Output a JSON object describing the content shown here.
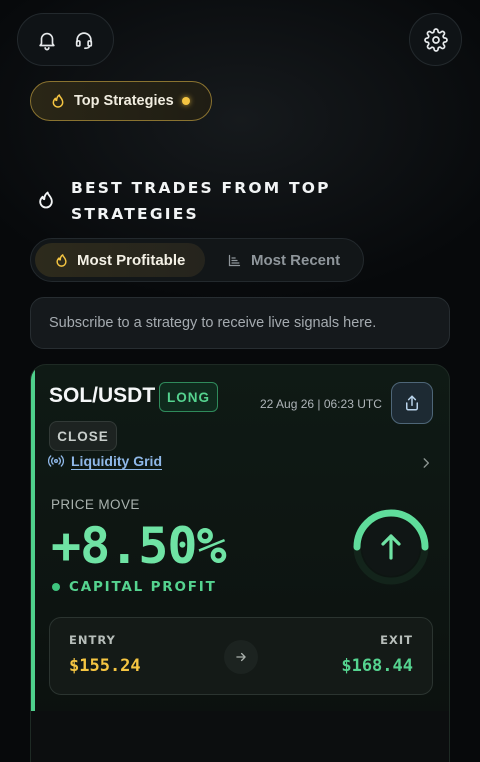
{
  "header": {
    "icons": [
      "bell-icon",
      "headset-icon",
      "gear-icon"
    ]
  },
  "top_strategies": {
    "label": "Top Strategies",
    "accent": "#f5c542"
  },
  "section": {
    "title": "BEST TRADES FROM TOP STRATEGIES"
  },
  "tabs": [
    {
      "label": "Most Profitable",
      "active": true,
      "icon": "flame-icon"
    },
    {
      "label": "Most Recent",
      "active": false,
      "icon": "list-icon"
    }
  ],
  "notice": {
    "text": "Subscribe to a strategy to receive live signals here."
  },
  "trade": {
    "pair": "SOL/USDT",
    "side": "LONG",
    "timestamp": "22 Aug 26 | 06:23 UTC",
    "status": "CLOSE",
    "strategy": "Liquidity Grid",
    "price_move_label": "PRICE MOVE",
    "price_move_value": "+8.50%",
    "capital_profit_label": "CAPITAL PROFIT",
    "entry_label": "ENTRY",
    "entry_value": "$155.24",
    "exit_label": "EXIT",
    "exit_value": "$168.44",
    "colors": {
      "profit": "#6fe3a4",
      "entry": "#f5c542",
      "exit": "#55d38f",
      "link": "#8fb8e8"
    }
  }
}
